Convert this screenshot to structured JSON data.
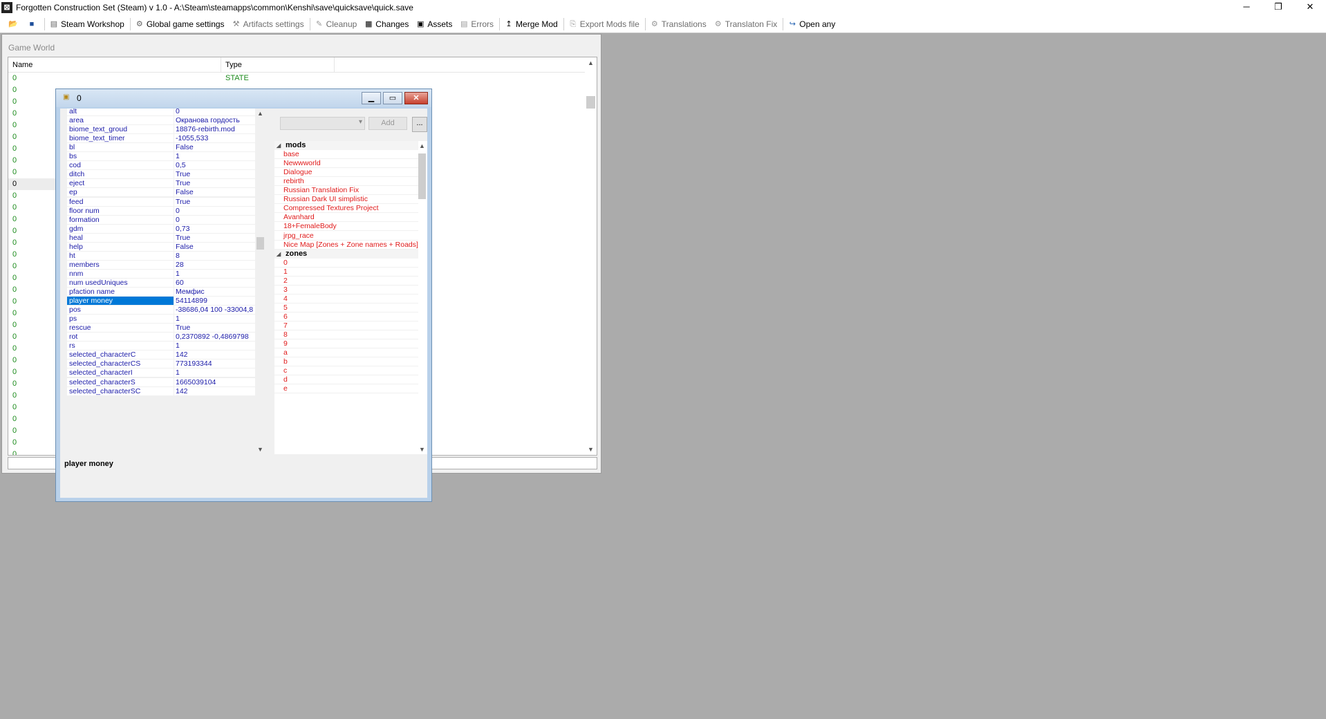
{
  "window": {
    "title": "Forgotten Construction Set (Steam) v 1.0 - A:\\Steam\\steamapps\\common\\Kenshi\\save\\quicksave\\quick.save",
    "minimize": "─",
    "maximize": "❐",
    "close": "✕"
  },
  "toolbar": {
    "items": [
      {
        "label": "Steam Workshop",
        "icon": "steam-icon"
      },
      {
        "label": "Global game settings",
        "icon": "gear-icon"
      },
      {
        "label": "Artifacts settings",
        "icon": "artifact-icon"
      },
      {
        "label": "Cleanup",
        "icon": "broom-icon"
      },
      {
        "label": "Changes",
        "icon": "changes-icon"
      },
      {
        "label": "Assets",
        "icon": "assets-icon"
      },
      {
        "label": "Errors",
        "icon": "errors-icon"
      },
      {
        "label": "Merge Mod",
        "icon": "merge-icon"
      },
      {
        "label": "Export Mods file",
        "icon": "export-icon"
      },
      {
        "label": "Translations",
        "icon": "translate-icon"
      },
      {
        "label": "Translaton Fix",
        "icon": "translate-fix-icon"
      },
      {
        "label": "Open any",
        "icon": "open-icon"
      }
    ]
  },
  "game_world": {
    "title": "Game World",
    "columns": [
      "Name",
      "Type"
    ],
    "rows": [
      {
        "name": "0",
        "type": "STATE"
      },
      {
        "name": "0",
        "type": ""
      },
      {
        "name": "0",
        "type": ""
      },
      {
        "name": "0",
        "type": ""
      },
      {
        "name": "0",
        "type": ""
      },
      {
        "name": "0",
        "type": ""
      },
      {
        "name": "0",
        "type": ""
      },
      {
        "name": "0",
        "type": ""
      },
      {
        "name": "0",
        "type": ""
      },
      {
        "name": "0",
        "type": ""
      },
      {
        "name": "0",
        "type": ""
      },
      {
        "name": "0",
        "type": ""
      },
      {
        "name": "0",
        "type": ""
      },
      {
        "name": "0",
        "type": ""
      },
      {
        "name": "0",
        "type": ""
      },
      {
        "name": "0",
        "type": ""
      },
      {
        "name": "0",
        "type": ""
      },
      {
        "name": "0",
        "type": ""
      },
      {
        "name": "0",
        "type": ""
      },
      {
        "name": "0",
        "type": ""
      },
      {
        "name": "0",
        "type": ""
      },
      {
        "name": "0",
        "type": ""
      },
      {
        "name": "0",
        "type": ""
      },
      {
        "name": "0",
        "type": ""
      },
      {
        "name": "0",
        "type": ""
      },
      {
        "name": "0",
        "type": ""
      },
      {
        "name": "0",
        "type": ""
      },
      {
        "name": "0",
        "type": ""
      },
      {
        "name": "0",
        "type": ""
      },
      {
        "name": "0",
        "type": ""
      },
      {
        "name": "0",
        "type": ""
      },
      {
        "name": "0",
        "type": ""
      },
      {
        "name": "0",
        "type": ""
      }
    ]
  },
  "record_window": {
    "title": "0",
    "properties": [
      {
        "key": "alt",
        "value": "0"
      },
      {
        "key": "area",
        "value": "Окранова гордость"
      },
      {
        "key": "biome_text_groud",
        "value": "18876-rebirth.mod"
      },
      {
        "key": "biome_text_timer",
        "value": "-1055,533"
      },
      {
        "key": "bl",
        "value": "False"
      },
      {
        "key": "bs",
        "value": "1"
      },
      {
        "key": "cod",
        "value": "0,5"
      },
      {
        "key": "ditch",
        "value": "True"
      },
      {
        "key": "eject",
        "value": "True"
      },
      {
        "key": "ep",
        "value": "False"
      },
      {
        "key": "feed",
        "value": "True"
      },
      {
        "key": "floor num",
        "value": "0"
      },
      {
        "key": "formation",
        "value": "0"
      },
      {
        "key": "gdm",
        "value": "0,73"
      },
      {
        "key": "heal",
        "value": "True"
      },
      {
        "key": "help",
        "value": "False"
      },
      {
        "key": "ht",
        "value": "8"
      },
      {
        "key": "members",
        "value": "28"
      },
      {
        "key": "nnm",
        "value": "1"
      },
      {
        "key": "num usedUniques",
        "value": "60"
      },
      {
        "key": "pfaction name",
        "value": "Мемфис"
      },
      {
        "key": "player money",
        "value": "54114899"
      },
      {
        "key": "pos",
        "value": "-38686,04 100 -33004,8"
      },
      {
        "key": "ps",
        "value": "1"
      },
      {
        "key": "rescue",
        "value": "True"
      },
      {
        "key": "rot",
        "value": "0,2370892 -0,4869798"
      },
      {
        "key": "rs",
        "value": "1"
      },
      {
        "key": "selected_characterC",
        "value": "142"
      },
      {
        "key": "selected_characterCS",
        "value": "773193344"
      },
      {
        "key": "selected_characterI",
        "value": "1"
      },
      {
        "key": "selected_characterS",
        "value": "1665039104"
      },
      {
        "key": "selected_characterSC",
        "value": "142"
      }
    ],
    "add_button": "Add",
    "more_button": "...",
    "groups": [
      {
        "name": "mods",
        "items": [
          "base",
          "Newwworld",
          "Dialogue",
          "rebirth",
          "Russian Translation Fix",
          "Russian Dark UI simplistic",
          "Compressed Textures Project",
          "Avanhard",
          "18+FemaleBody",
          "jrpg_race",
          "Nice Map [Zones + Zone names + Roads]"
        ]
      },
      {
        "name": "zones",
        "items": [
          "0",
          "1",
          "2",
          "3",
          "4",
          "5",
          "6",
          "7",
          "8",
          "9",
          "a",
          "b",
          "c",
          "d",
          "e"
        ]
      }
    ],
    "description_title": "player money"
  }
}
